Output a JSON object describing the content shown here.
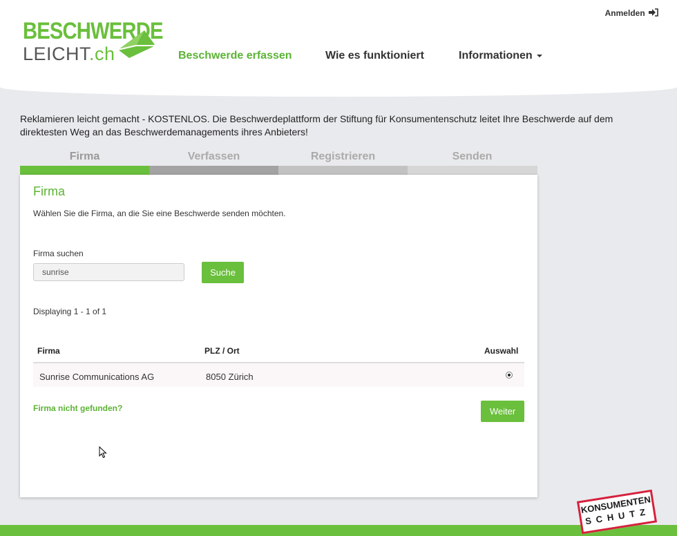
{
  "header": {
    "logo": {
      "line1": "BESCHWERDE",
      "line2_main": "LEICHT",
      "line2_suffix": ".ch"
    },
    "nav": [
      {
        "label": "Beschwerde erfassen",
        "active": true
      },
      {
        "label": "Wie es funktioniert",
        "active": false
      },
      {
        "label": "Informationen",
        "active": false,
        "dropdown": true
      }
    ],
    "login": {
      "label": "Anmelden",
      "icon": "sign-in-icon"
    }
  },
  "intro": "Reklamieren leicht gemacht - KOSTENLOS. Die Beschwerdeplattform der Stiftung für Konsumentenschutz leitet Ihre Beschwerde auf dem direktesten Weg an das Beschwerdemanagements ihres Anbieters!",
  "steps": [
    {
      "label": "Firma",
      "state": "active",
      "bar_color": "#6abf3c"
    },
    {
      "label": "Verfassen",
      "state": "pending",
      "bar_color": "#a3a3a3"
    },
    {
      "label": "Registrieren",
      "state": "pending",
      "bar_color": "#c2c2c2"
    },
    {
      "label": "Senden",
      "state": "pending",
      "bar_color": "#d6d6d6"
    }
  ],
  "card": {
    "title": "Firma",
    "description": "Wählen Sie die Firma, an die Sie eine Beschwerde senden möchten.",
    "search": {
      "label": "Firma suchen",
      "value": "sunrise",
      "button": "Suche"
    },
    "results_count": "Displaying 1 - 1 of 1",
    "table": {
      "columns": [
        "Firma",
        "PLZ / Ort",
        "Auswahl"
      ],
      "rows": [
        {
          "firma": "Sunrise Communications AG",
          "plz_ort": "8050 Zürich",
          "selected": true
        }
      ]
    },
    "not_found_link": "Firma nicht gefunden?",
    "next_button": "Weiter"
  },
  "stamp": {
    "line1": "KONSUMENTEN",
    "line2": "SCHUTZ"
  },
  "colors": {
    "accent": "#6abf3c",
    "stamp_red": "#d6203c",
    "background": "#e9eaed"
  }
}
